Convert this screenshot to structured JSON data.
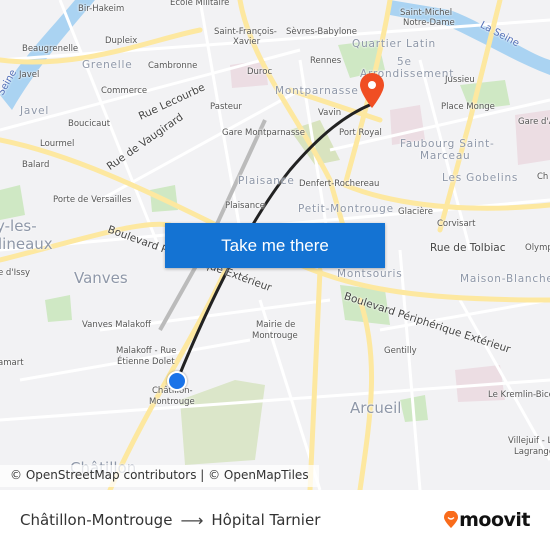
{
  "map": {
    "labels": [
      "Bir-Hakeim",
      "Ecole Militaire",
      "Saint-François-",
      "Xavier",
      "Sèvres-Babylone",
      "Saint-Michel",
      "Notre-Dame",
      "Quartier Latin",
      "5e",
      "Arrondissement",
      "La Seine",
      "Beaugrenelle",
      "Dupleix",
      "Grenelle",
      "Cambronne",
      "Duroc",
      "Rennes",
      "Jussieu",
      "Javel",
      "Commerce",
      "Rue Lecourbe",
      "Pasteur",
      "Montparnasse",
      "Vavin",
      "Place Monge",
      "Gare d'A",
      "Javel",
      "Boucicaut",
      "Rue de Vaugirard",
      "Gare Montparnasse",
      "Port Royal",
      "Faubourg Saint-",
      "Marceau",
      "Lourmel",
      "Balard",
      "Plaisance",
      "Denfert-Rochereau",
      "Les Gobelins",
      "Ch",
      "Porte de Versailles",
      "Plaisance",
      "Petit-Montrouge",
      "Glacière",
      "Corvisart",
      "y-les-",
      "lineaux",
      "Boulevard Pé",
      "Rue de Tolbiac",
      "Olymp",
      "Vanves",
      "Montsouris",
      "Maison-Blanche",
      "e d'Issy",
      "rique Extérieur",
      "Boulevard Périphérique Extérieur",
      "Vanves Malakoff",
      "Mairie de",
      "Montrouge",
      "Gentilly",
      "Malakoff - Rue",
      "Étienne Dolet",
      "amart",
      "Châtillon-",
      "Montrouge",
      "Arcueil",
      "Le Kremlin-Bicê",
      "Villejuif - L",
      "Lagrange",
      "Châtillon",
      "Seine"
    ],
    "origin_marker_color": "#1a73e8",
    "destination_pin_color": "#f04e23",
    "route_color": "#222222"
  },
  "cta": {
    "label": "Take me there",
    "color": "#1473d3"
  },
  "attribution": "© OpenStreetMap contributors | © OpenMapTiles",
  "footer": {
    "origin": "Châtillon-Montrouge",
    "arrow_icon": "arrow-right-icon",
    "destination": "Hôpital Tarnier",
    "brand": "moovit",
    "brand_color": "#f96b1b"
  }
}
